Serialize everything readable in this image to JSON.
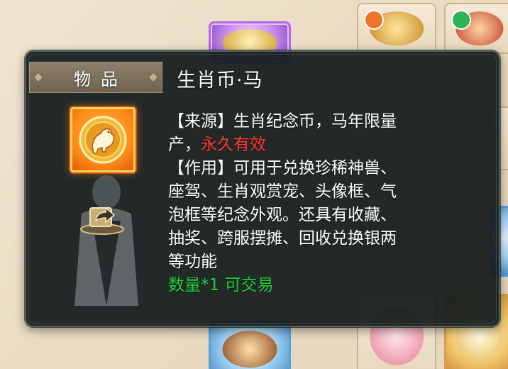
{
  "category_tab": {
    "label": "物品"
  },
  "item": {
    "name": "生肖币·马",
    "icon": "zodiac-horse-coin-icon",
    "source_line1": "【来源】生肖纪念币，马年限量",
    "source_line2_prefix": "产，",
    "validity": "永久有效",
    "use_line1": "【作用】可用于兑换珍稀神兽、",
    "use_line2": "座驾、生肖观赏宠、头像框、气",
    "use_line3": "泡框等纪念外观。还具有收藏、",
    "use_line4": "抽奖、跨服摆摊、回收兑换银两",
    "use_line5": "等功能",
    "quantity_tradable": "数量*1 可交易"
  },
  "share_button": {
    "icon": "share-arrow-icon"
  },
  "colors": {
    "validity": "#ff3b30",
    "quantity": "#1fd13a",
    "panel_bg": "#161d1e"
  }
}
